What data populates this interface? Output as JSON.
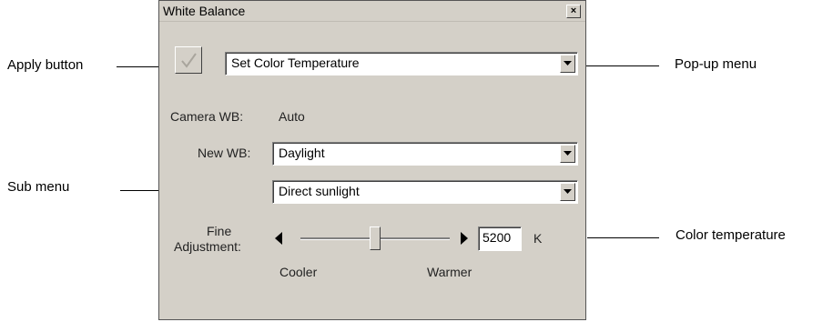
{
  "window": {
    "title": "White Balance",
    "close_glyph": "×"
  },
  "toolbar": {
    "mode_value": "Set Color Temperature"
  },
  "camera_wb": {
    "label": "Camera WB:",
    "value": "Auto"
  },
  "new_wb": {
    "label": "New WB:",
    "value": "Daylight",
    "sub_value": "Direct sunlight"
  },
  "fine": {
    "label_line1": "Fine",
    "label_line2": "Adjustment:",
    "cooler": "Cooler",
    "warmer": "Warmer",
    "temperature": "5200",
    "unit": "K",
    "slider_fraction": 0.5
  },
  "callouts": {
    "apply": "Apply button",
    "popup": "Pop-up menu",
    "sub": "Sub menu",
    "colortemp": "Color temperature"
  }
}
